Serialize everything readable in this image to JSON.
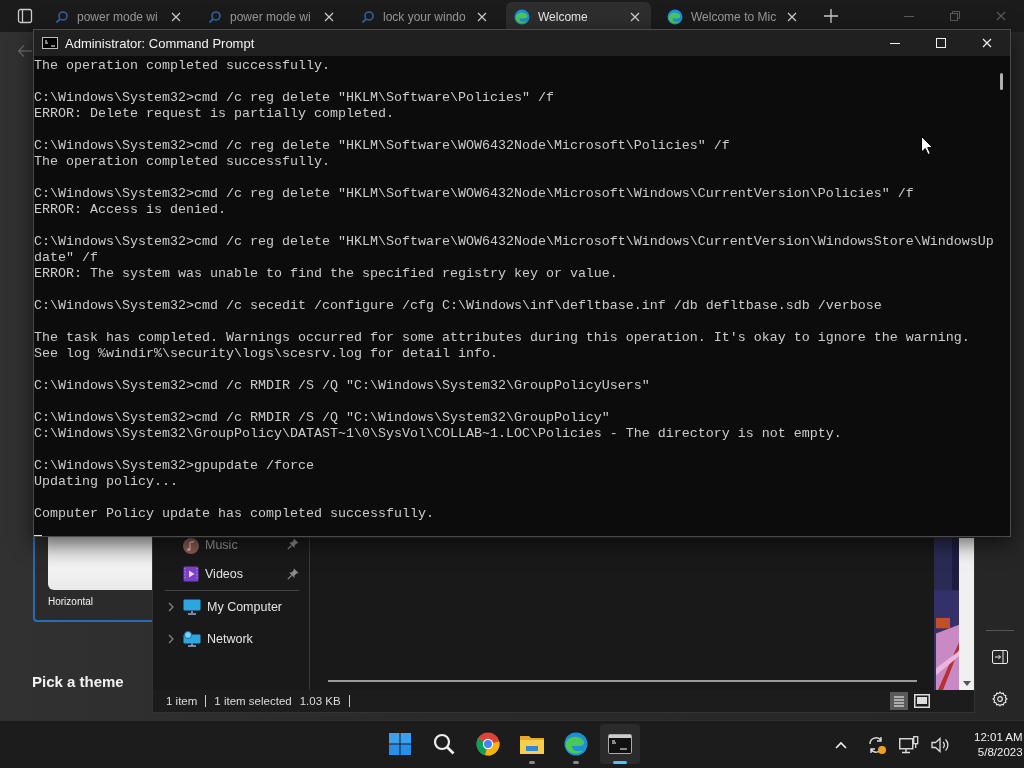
{
  "browser": {
    "tabs": [
      {
        "title": "power mode wi",
        "kind": "search",
        "selected": false
      },
      {
        "title": "power mode wi",
        "kind": "search",
        "selected": false
      },
      {
        "title": "lock your windo",
        "kind": "search",
        "selected": false
      },
      {
        "title": "Welcome",
        "kind": "edge",
        "selected": true
      },
      {
        "title": "Welcome to Mic",
        "kind": "edge",
        "selected": false
      }
    ]
  },
  "settings": {
    "card_label": "Horizontal",
    "heading": "Pick a theme"
  },
  "explorer": {
    "nav_items": [
      {
        "label": "Music",
        "kind": "pinned"
      },
      {
        "label": "Videos",
        "kind": "pinned"
      },
      {
        "label": "My Computer",
        "kind": "expandable"
      },
      {
        "label": "Network",
        "kind": "expandable"
      }
    ],
    "status": [
      "1 item",
      "1 item selected",
      "1.03 KB"
    ]
  },
  "cmd": {
    "title": "Administrator: Command Prompt",
    "blocks": [
      [
        "The operation completed successfully."
      ],
      [
        "C:\\Windows\\System32>cmd /c reg delete \"HKLM\\Software\\Policies\" /f",
        "ERROR: Delete request is partially completed."
      ],
      [
        "C:\\Windows\\System32>cmd /c reg delete \"HKLM\\Software\\WOW6432Node\\Microsoft\\Policies\" /f",
        "The operation completed successfully."
      ],
      [
        "C:\\Windows\\System32>cmd /c reg delete \"HKLM\\Software\\WOW6432Node\\Microsoft\\Windows\\CurrentVersion\\Policies\" /f",
        "ERROR: Access is denied."
      ],
      [
        "C:\\Windows\\System32>cmd /c reg delete \"HKLM\\Software\\WOW6432Node\\Microsoft\\Windows\\CurrentVersion\\WindowsStore\\WindowsUp",
        "date\" /f",
        "ERROR: The system was unable to find the specified registry key or value."
      ],
      [
        "C:\\Windows\\System32>cmd /c secedit /configure /cfg C:\\Windows\\inf\\defltbase.inf /db defltbase.sdb /verbose"
      ],
      [
        "The task has completed. Warnings occurred for some attributes during this operation. It's okay to ignore the warning.",
        "See log %windir%\\security\\logs\\scesrv.log for detail info."
      ],
      [
        "C:\\Windows\\System32>cmd /c RMDIR /S /Q \"C:\\Windows\\System32\\GroupPolicyUsers\""
      ],
      [
        "C:\\Windows\\System32>cmd /c RMDIR /S /Q \"C:\\Windows\\System32\\GroupPolicy\"",
        "C:\\Windows\\System32\\GroupPolicy\\DATAST~1\\0\\SysVol\\COLLAB~1.LOC\\Policies - The directory is not empty."
      ],
      [
        "C:\\Windows\\System32>gpupdate /force",
        "Updating policy..."
      ],
      [
        "Computer Policy update has completed successfully."
      ]
    ]
  },
  "taskbar": {
    "apps": [
      {
        "kind": "start",
        "running": false,
        "active": false
      },
      {
        "kind": "search",
        "running": false,
        "active": false
      },
      {
        "kind": "chrome",
        "running": false,
        "active": false
      },
      {
        "kind": "folder",
        "running": true,
        "active": false
      },
      {
        "kind": "edge",
        "running": true,
        "active": false
      },
      {
        "kind": "terminal",
        "running": true,
        "active": true
      }
    ],
    "time": "12:01 AM",
    "date": "5/8/2023"
  }
}
